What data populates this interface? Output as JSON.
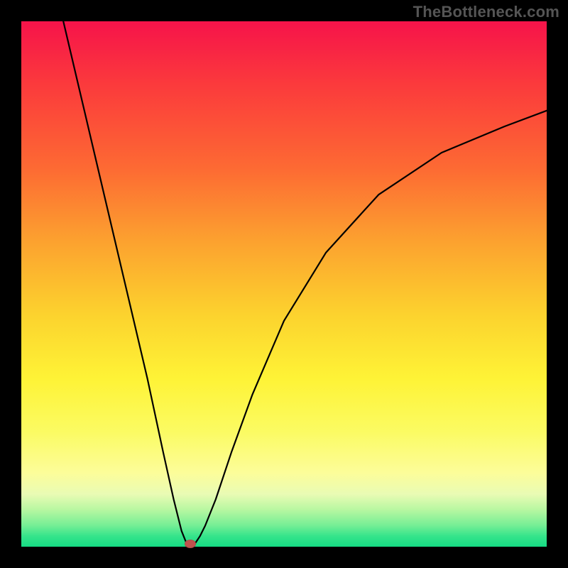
{
  "watermark": "TheBottleneck.com",
  "chart_data": {
    "type": "line",
    "title": "",
    "xlabel": "",
    "ylabel": "",
    "xlim": [
      0,
      100
    ],
    "ylim": [
      0,
      100
    ],
    "grid": false,
    "series": [
      {
        "name": "curve",
        "x": [
          8,
          12,
          16,
          20,
          24,
          27,
          29,
          30.5,
          31.5,
          32,
          33,
          34,
          35,
          37,
          40,
          44,
          50,
          58,
          68,
          80,
          92,
          100
        ],
        "y": [
          100,
          83,
          66,
          49,
          32,
          18,
          9,
          3,
          0.5,
          0,
          0.5,
          2,
          4,
          9,
          18,
          29,
          43,
          56,
          67,
          75,
          80,
          83
        ]
      }
    ],
    "marker": {
      "x": 32.2,
      "y": 0.6,
      "color": "#c0524e"
    },
    "background_gradient": {
      "top": "#f6134a",
      "bottom": "#16db84"
    }
  }
}
